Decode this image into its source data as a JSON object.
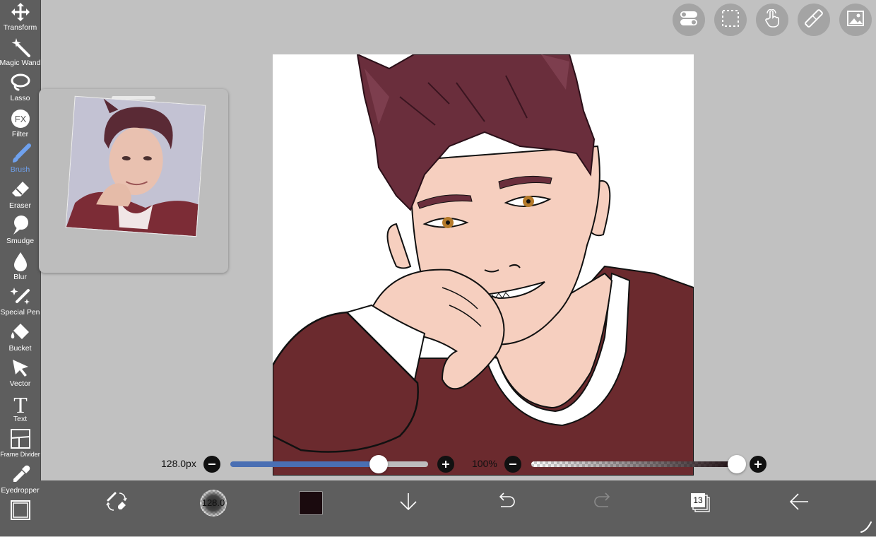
{
  "toolbar": {
    "tools": [
      {
        "label": "Transform",
        "icon": "move-arrows-icon"
      },
      {
        "label": "Magic Wand",
        "icon": "magic-wand-icon"
      },
      {
        "label": "Lasso",
        "icon": "lasso-icon"
      },
      {
        "label": "Filter",
        "icon": "fx-icon"
      },
      {
        "label": "Brush",
        "icon": "brush-icon",
        "active": true
      },
      {
        "label": "Eraser",
        "icon": "eraser-icon"
      },
      {
        "label": "Smudge",
        "icon": "smudge-icon"
      },
      {
        "label": "Blur",
        "icon": "droplet-icon"
      },
      {
        "label": "Special Pen",
        "icon": "sparkle-pen-icon"
      },
      {
        "label": "Bucket",
        "icon": "bucket-icon"
      },
      {
        "label": "Vector",
        "icon": "cursor-arrow-icon"
      },
      {
        "label": "Text",
        "icon": "text-icon"
      },
      {
        "label": "Frame Divider",
        "icon": "frame-divider-icon"
      },
      {
        "label": "Eyedropper",
        "icon": "eyedropper-icon"
      },
      {
        "label": "",
        "icon": "canvas-frame-icon"
      }
    ]
  },
  "top_buttons": [
    "toggle-icon",
    "selection-icon",
    "touch-hand-icon",
    "ruler-icon",
    "gallery-icon"
  ],
  "brush_size": {
    "text": "128.0px",
    "fill": 0.75
  },
  "opacity": {
    "text": "100%",
    "fill": 1.0
  },
  "bottom_bar": {
    "brush_preview_text": "128.0",
    "color": "#1a0a0e",
    "layer_count": "13"
  },
  "colors": {
    "accent": "#6fa1ee",
    "slider_fill": "#4a6fb3",
    "shirt": "#6b2a2e",
    "hair": "#6a2e3c",
    "skin": "#f6cfbf"
  }
}
